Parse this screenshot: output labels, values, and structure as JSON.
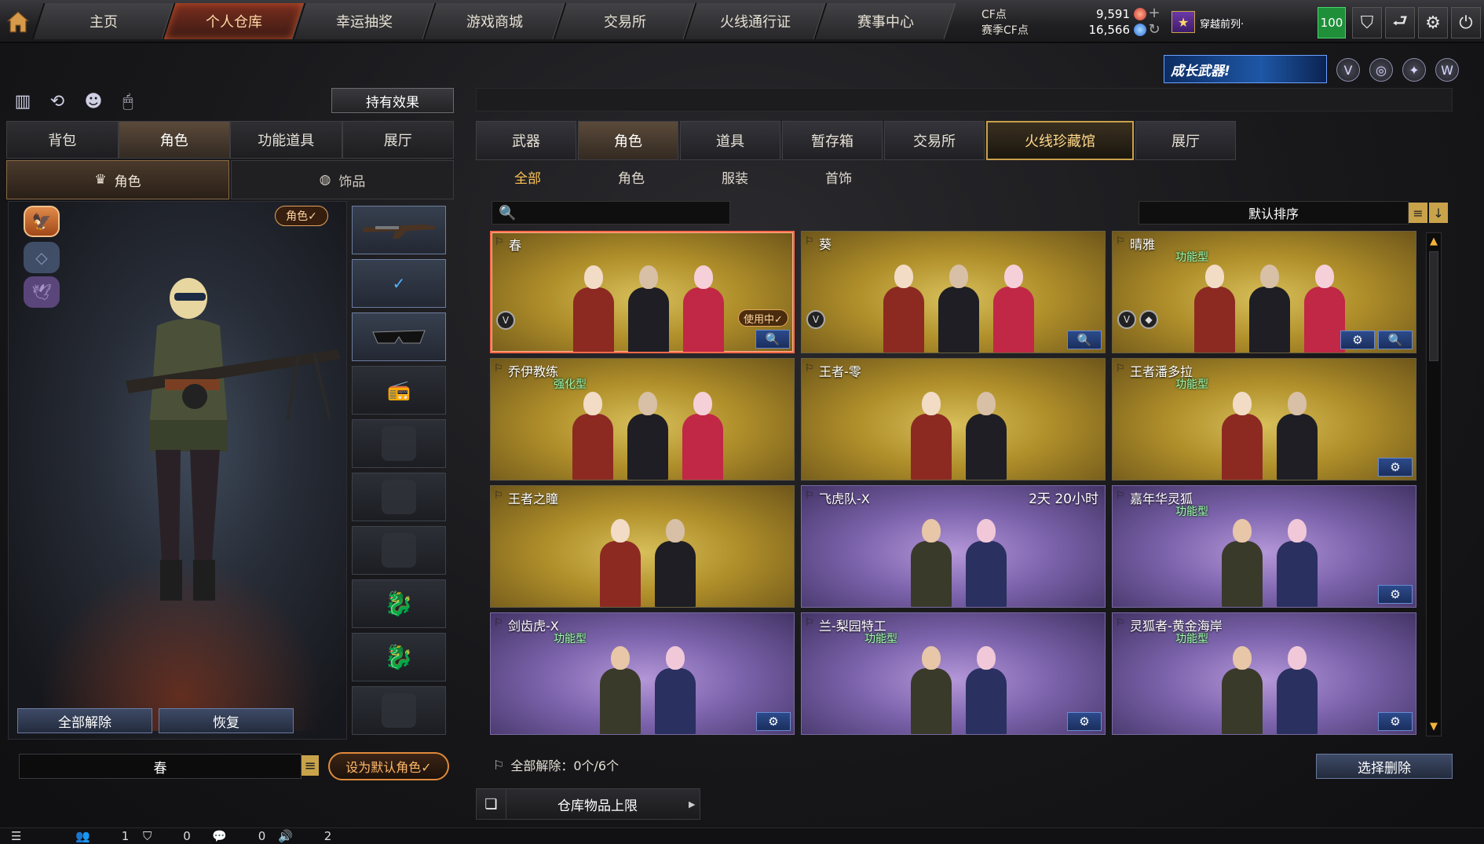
{
  "nav": {
    "tabs": [
      "主页",
      "个人仓库",
      "幸运抽奖",
      "游戏商城",
      "交易所",
      "火线通行证",
      "赛事中心"
    ],
    "active_index": 1
  },
  "currency": {
    "cf_label": "CF点",
    "cf_value": "9,591",
    "season_label": "赛季CF点",
    "season_value": "16,566"
  },
  "profile": {
    "rank_name": "穿越前列·",
    "level": "100"
  },
  "promo": {
    "label": "成长武器!"
  },
  "left": {
    "effect_button": "持有效果",
    "tabs": [
      "背包",
      "角色",
      "功能道具",
      "展厅"
    ],
    "active_tab": 1,
    "subtabs": [
      "角色",
      "饰品"
    ],
    "role_tag": "角色✓",
    "release_all": "全部解除",
    "restore": "恢复",
    "current_name": "春",
    "set_default": "设为默认角色✓"
  },
  "right": {
    "tabs": [
      "武器",
      "角色",
      "道具",
      "暂存箱",
      "交易所",
      "火线珍藏馆",
      "展厅"
    ],
    "active_tab": 1,
    "subtabs": [
      "全部",
      "角色",
      "服装",
      "首饰"
    ],
    "active_subtab": 0,
    "sort_label": "默认排序",
    "unload_label": "全部解除：",
    "unload_value": "0个/6个",
    "select_delete": "选择删除",
    "limit_label": "仓库物品上限"
  },
  "cards": [
    {
      "name": "春",
      "style": "gold",
      "tag": "",
      "timer": "",
      "in_use": "使用中✓",
      "selected": true,
      "badges": [
        "V"
      ],
      "buttons": [
        "search"
      ]
    },
    {
      "name": "葵",
      "style": "gold",
      "tag": "",
      "timer": "",
      "in_use": "",
      "selected": false,
      "badges": [
        "V"
      ],
      "buttons": [
        "search"
      ]
    },
    {
      "name": "晴雅",
      "style": "gold",
      "tag": "功能型",
      "timer": "",
      "in_use": "",
      "selected": false,
      "badges": [
        "V",
        "S"
      ],
      "buttons": [
        "gear",
        "search"
      ]
    },
    {
      "name": "乔伊教练",
      "style": "gold",
      "tag": "强化型",
      "timer": "",
      "in_use": "",
      "selected": false,
      "badges": [],
      "buttons": []
    },
    {
      "name": "王者-零",
      "style": "gold",
      "tag": "",
      "timer": "",
      "in_use": "",
      "selected": false,
      "badges": [],
      "buttons": []
    },
    {
      "name": "王者潘多拉",
      "style": "gold",
      "tag": "功能型",
      "timer": "",
      "in_use": "",
      "selected": false,
      "badges": [],
      "buttons": [
        "gear"
      ]
    },
    {
      "name": "王者之瞳",
      "style": "gold",
      "tag": "",
      "timer": "",
      "in_use": "",
      "selected": false,
      "badges": [],
      "buttons": []
    },
    {
      "name": "飞虎队-X",
      "style": "purple",
      "tag": "",
      "timer": "2天 20小时",
      "in_use": "",
      "selected": false,
      "badges": [],
      "buttons": []
    },
    {
      "name": "嘉年华灵狐",
      "style": "purple",
      "tag": "功能型",
      "timer": "",
      "in_use": "",
      "selected": false,
      "badges": [],
      "buttons": [
        "gear"
      ]
    },
    {
      "name": "剑齿虎-X",
      "style": "purple",
      "tag": "功能型",
      "timer": "",
      "in_use": "",
      "selected": false,
      "badges": [],
      "buttons": [
        "gear"
      ]
    },
    {
      "name": "兰-梨园特工",
      "style": "purple",
      "tag": "功能型",
      "timer": "",
      "in_use": "",
      "selected": false,
      "badges": [],
      "buttons": [
        "gear"
      ]
    },
    {
      "name": "灵狐者-黄金海岸",
      "style": "purple",
      "tag": "功能型",
      "timer": "",
      "in_use": "",
      "selected": false,
      "badges": [],
      "buttons": [
        "gear"
      ]
    }
  ],
  "statusbar": {
    "players": "1",
    "shield": "0",
    "chat": "0",
    "volume": "2"
  },
  "colors": {
    "gold_card": "#b08f2a",
    "purple_card": "#7d64ad",
    "accent_orange": "#e08a3c",
    "button_blue": "#2c4b8c"
  }
}
